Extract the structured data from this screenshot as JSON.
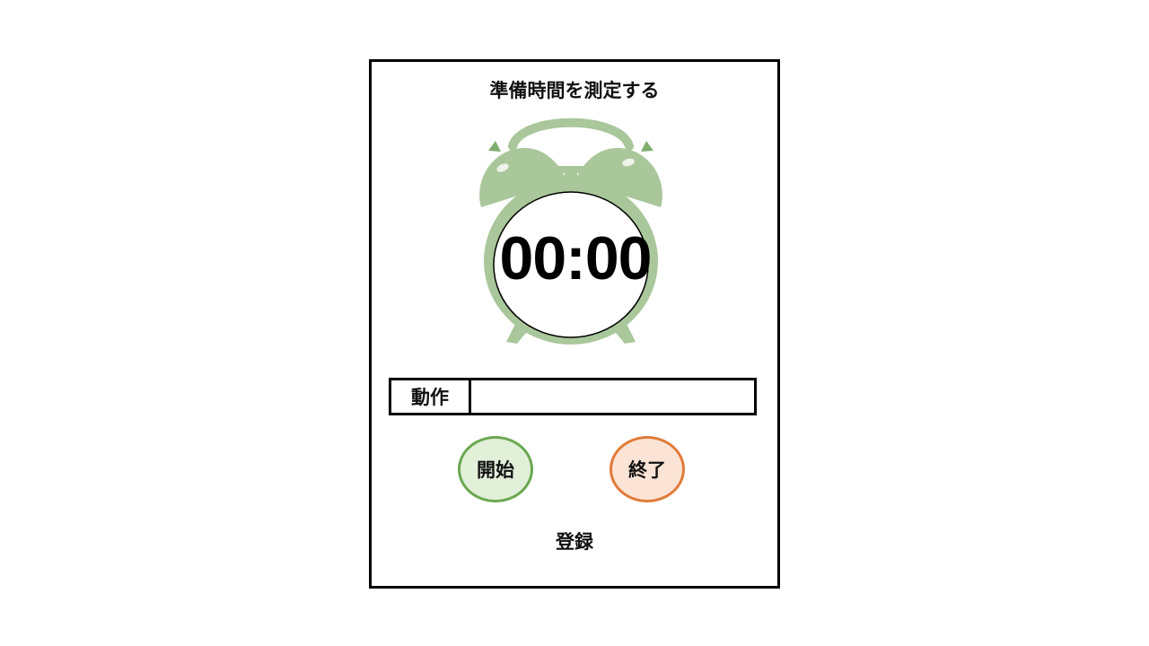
{
  "title": "準備時間を測定する",
  "timer": {
    "display": "00:00"
  },
  "action": {
    "label": "動作",
    "value": ""
  },
  "buttons": {
    "start_label": "開始",
    "end_label": "終了",
    "register_label": "登録"
  },
  "colors": {
    "clock_green": "#a9c79a",
    "start_border": "#6aa84f",
    "start_fill": "#e2efd9",
    "end_border": "#e07b39",
    "end_fill": "#fbe4d5"
  },
  "icons": {
    "clock": "alarm-clock-icon"
  }
}
